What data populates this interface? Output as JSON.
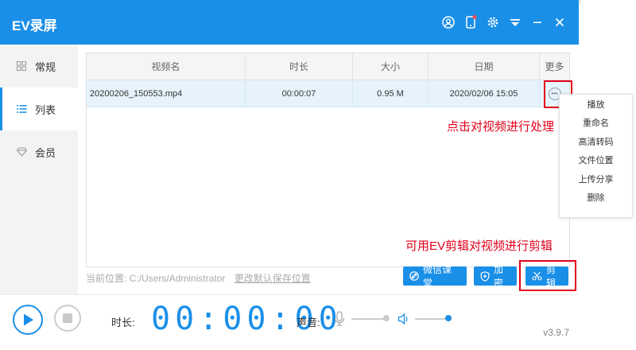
{
  "app": {
    "title": "EV录屏",
    "version": "v3.9.7"
  },
  "sidebar": {
    "items": [
      {
        "label": "常规"
      },
      {
        "label": "列表"
      },
      {
        "label": "会员"
      }
    ]
  },
  "table": {
    "headers": [
      "视频名",
      "时长",
      "大小",
      "日期",
      "更多"
    ],
    "rows": [
      {
        "name": "20200206_150553.mp4",
        "duration": "00:00:07",
        "size": "0.95 M",
        "date": "2020/02/06 15:05"
      }
    ]
  },
  "footer": {
    "path_label": "当前位置:",
    "path": "C:/Users/Administrator",
    "change_link": "更改默认保存位置",
    "buttons": {
      "wechat": "微信课堂",
      "encrypt": "加密",
      "edit": "剪辑"
    }
  },
  "bottom": {
    "duration_label": "时长:",
    "timer": "00:00:00",
    "volume_label": "声音:"
  },
  "context_menu": {
    "items": [
      "播放",
      "重命名",
      "高清转码",
      "文件位置",
      "上传分享",
      "删除"
    ]
  },
  "annotations": {
    "more_hint": "点击对视频进行处理",
    "edit_hint": "可用EV剪辑对视频进行剪辑"
  },
  "colors": {
    "accent": "#1a8fe8",
    "annotation_red": "#e3001b"
  }
}
